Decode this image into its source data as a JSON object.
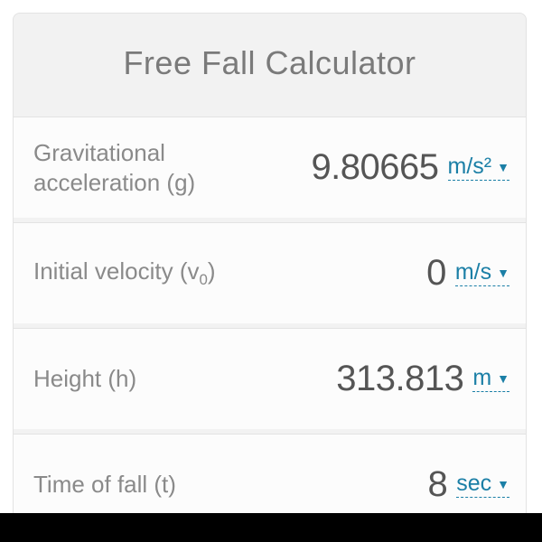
{
  "title": "Free Fall Calculator",
  "rows": [
    {
      "label_html": "Gravitational acceleration (g)",
      "value": "9.80665",
      "unit_html": "m/s²"
    },
    {
      "label_html": "Initial velocity (v<sub>0</sub>)",
      "value": "0",
      "unit_html": "m/s"
    },
    {
      "label_html": "Height (h)",
      "value": "313.813",
      "unit_html": "m"
    },
    {
      "label_html": "Time of fall (t)",
      "value": "8",
      "unit_html": "sec"
    }
  ]
}
